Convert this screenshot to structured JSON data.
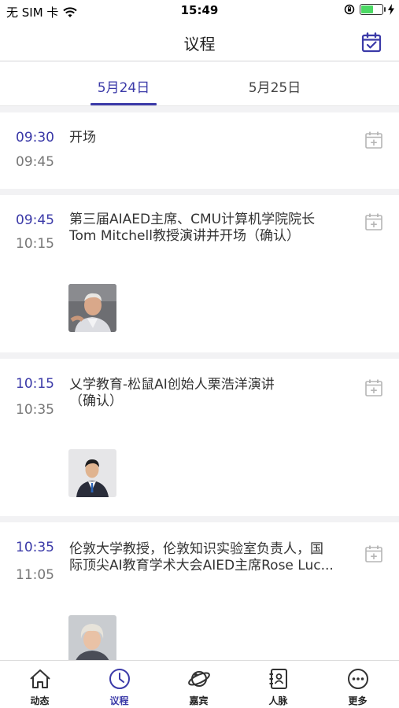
{
  "status_bar": {
    "carrier": "无 SIM 卡",
    "time": "15:49",
    "battery_level": 0.55,
    "battery_color": "#4cd964"
  },
  "header": {
    "title": "议程",
    "right_icon": "calendar-check-icon"
  },
  "tabs": [
    {
      "label": "5月24日",
      "active": true
    },
    {
      "label": "5月25日",
      "active": false
    }
  ],
  "sessions": [
    {
      "start": "09:30",
      "end": "09:45",
      "title_lines": [
        "开场"
      ],
      "speaker_photo": false
    },
    {
      "start": "09:45",
      "end": "10:15",
      "title_lines": [
        "第三届AIAED主席、CMU计算机学院院长",
        "Tom Mitchell教授演讲并开场（确认）"
      ],
      "speaker_photo": true
    },
    {
      "start": "10:15",
      "end": "10:35",
      "title_lines": [
        "乂学教育-松鼠AI创始人栗浩洋演讲",
        "（确认）"
      ],
      "speaker_photo": true
    },
    {
      "start": "10:35",
      "end": "11:05",
      "title_lines": [
        "伦敦大学教授，伦敦知识实验室负责人，国",
        "际顶尖AI教育学术大会AIED主席Rose Luc..."
      ],
      "speaker_photo": true
    }
  ],
  "bottom_nav": [
    {
      "label": "动态",
      "icon": "home-icon",
      "active": false
    },
    {
      "label": "议程",
      "icon": "clock-icon",
      "active": true
    },
    {
      "label": "嘉宾",
      "icon": "planet-icon",
      "active": false
    },
    {
      "label": "人脉",
      "icon": "contacts-book-icon",
      "active": false
    },
    {
      "label": "更多",
      "icon": "more-icon",
      "active": false
    }
  ],
  "colors": {
    "accent": "#3b3aa8",
    "background": "#f2f2f4"
  }
}
